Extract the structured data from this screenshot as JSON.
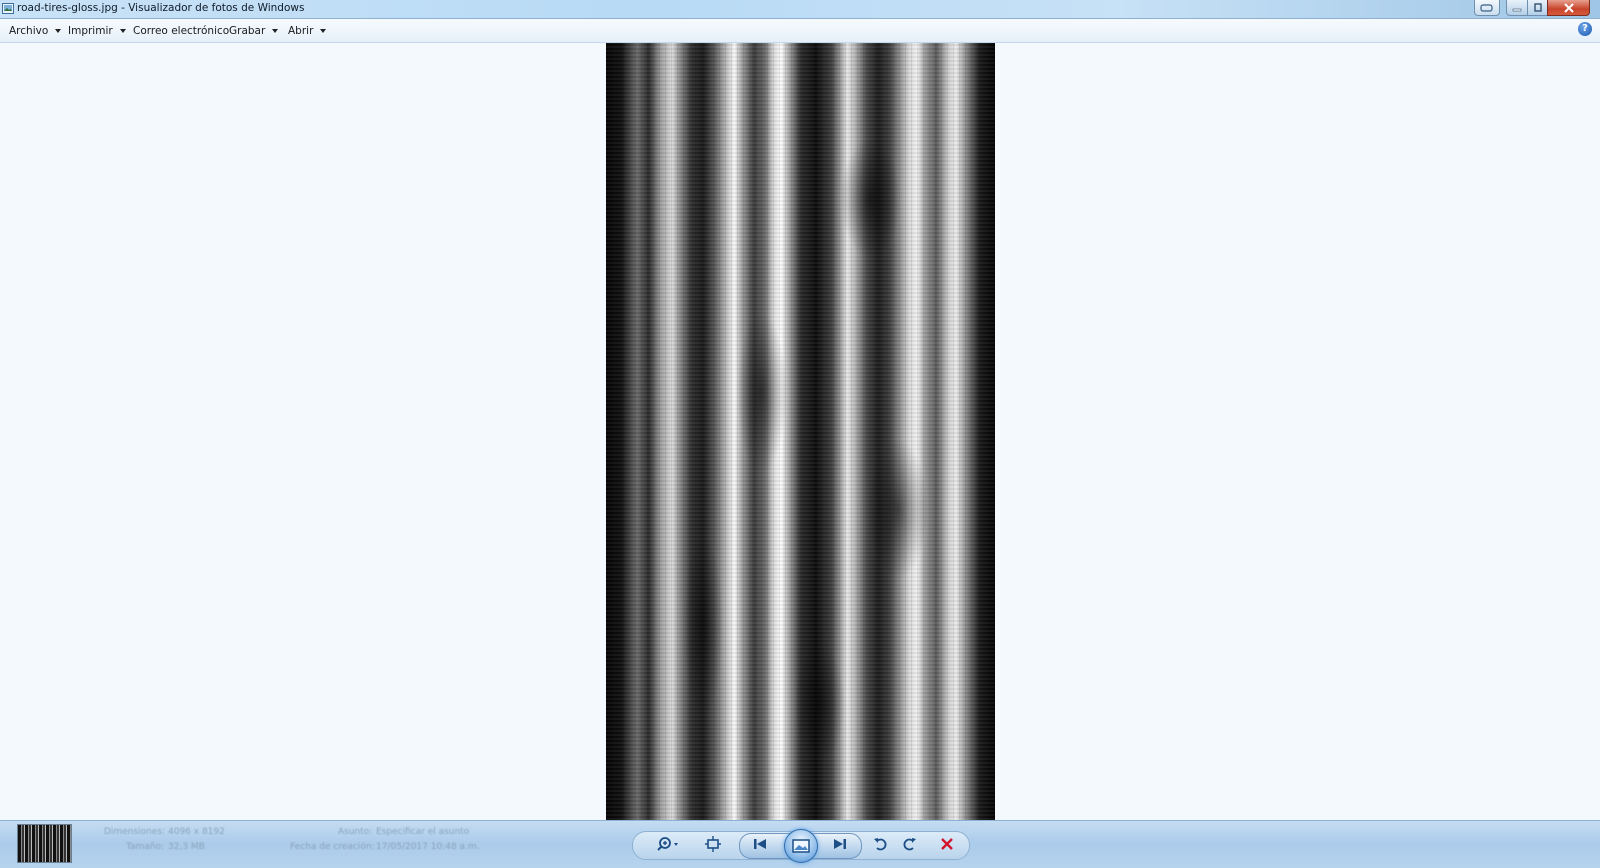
{
  "window": {
    "title": "road-tires-gloss.jpg - Visualizador de fotos de Windows"
  },
  "menu": {
    "items": [
      {
        "label": "Archivo",
        "has_dropdown": true
      },
      {
        "label": "Imprimir",
        "has_dropdown": true
      },
      {
        "label": "Correo electrónico",
        "has_dropdown": false
      },
      {
        "label": "Grabar",
        "has_dropdown": true
      },
      {
        "label": "Abrir",
        "has_dropdown": true
      }
    ],
    "help_label": "?"
  },
  "viewer": {
    "image_file": "road-tires-gloss.jpg"
  },
  "status": {
    "dimensions_label": "Dimensiones:",
    "dimensions_value": "4096 x 8192",
    "size_label": "Tamaño:",
    "size_value": "32,3 MB",
    "author_label": "Asunto:",
    "author_value": "Especificar el asunto",
    "date_label": "Fecha de creación:",
    "date_value": "17/05/2017 10:48 a.m."
  },
  "controls": {
    "zoom": "zoom-icon",
    "fit": "fit-window-icon",
    "previous": "previous-icon",
    "slideshow": "slideshow-icon",
    "next": "next-icon",
    "rotate_left": "rotate-ccw-icon",
    "rotate_right": "rotate-cw-icon",
    "delete": "delete-icon"
  },
  "colors": {
    "accent": "#1d4f86",
    "delete": "#d2142c",
    "viewer_bg": "#f4f9fe"
  }
}
